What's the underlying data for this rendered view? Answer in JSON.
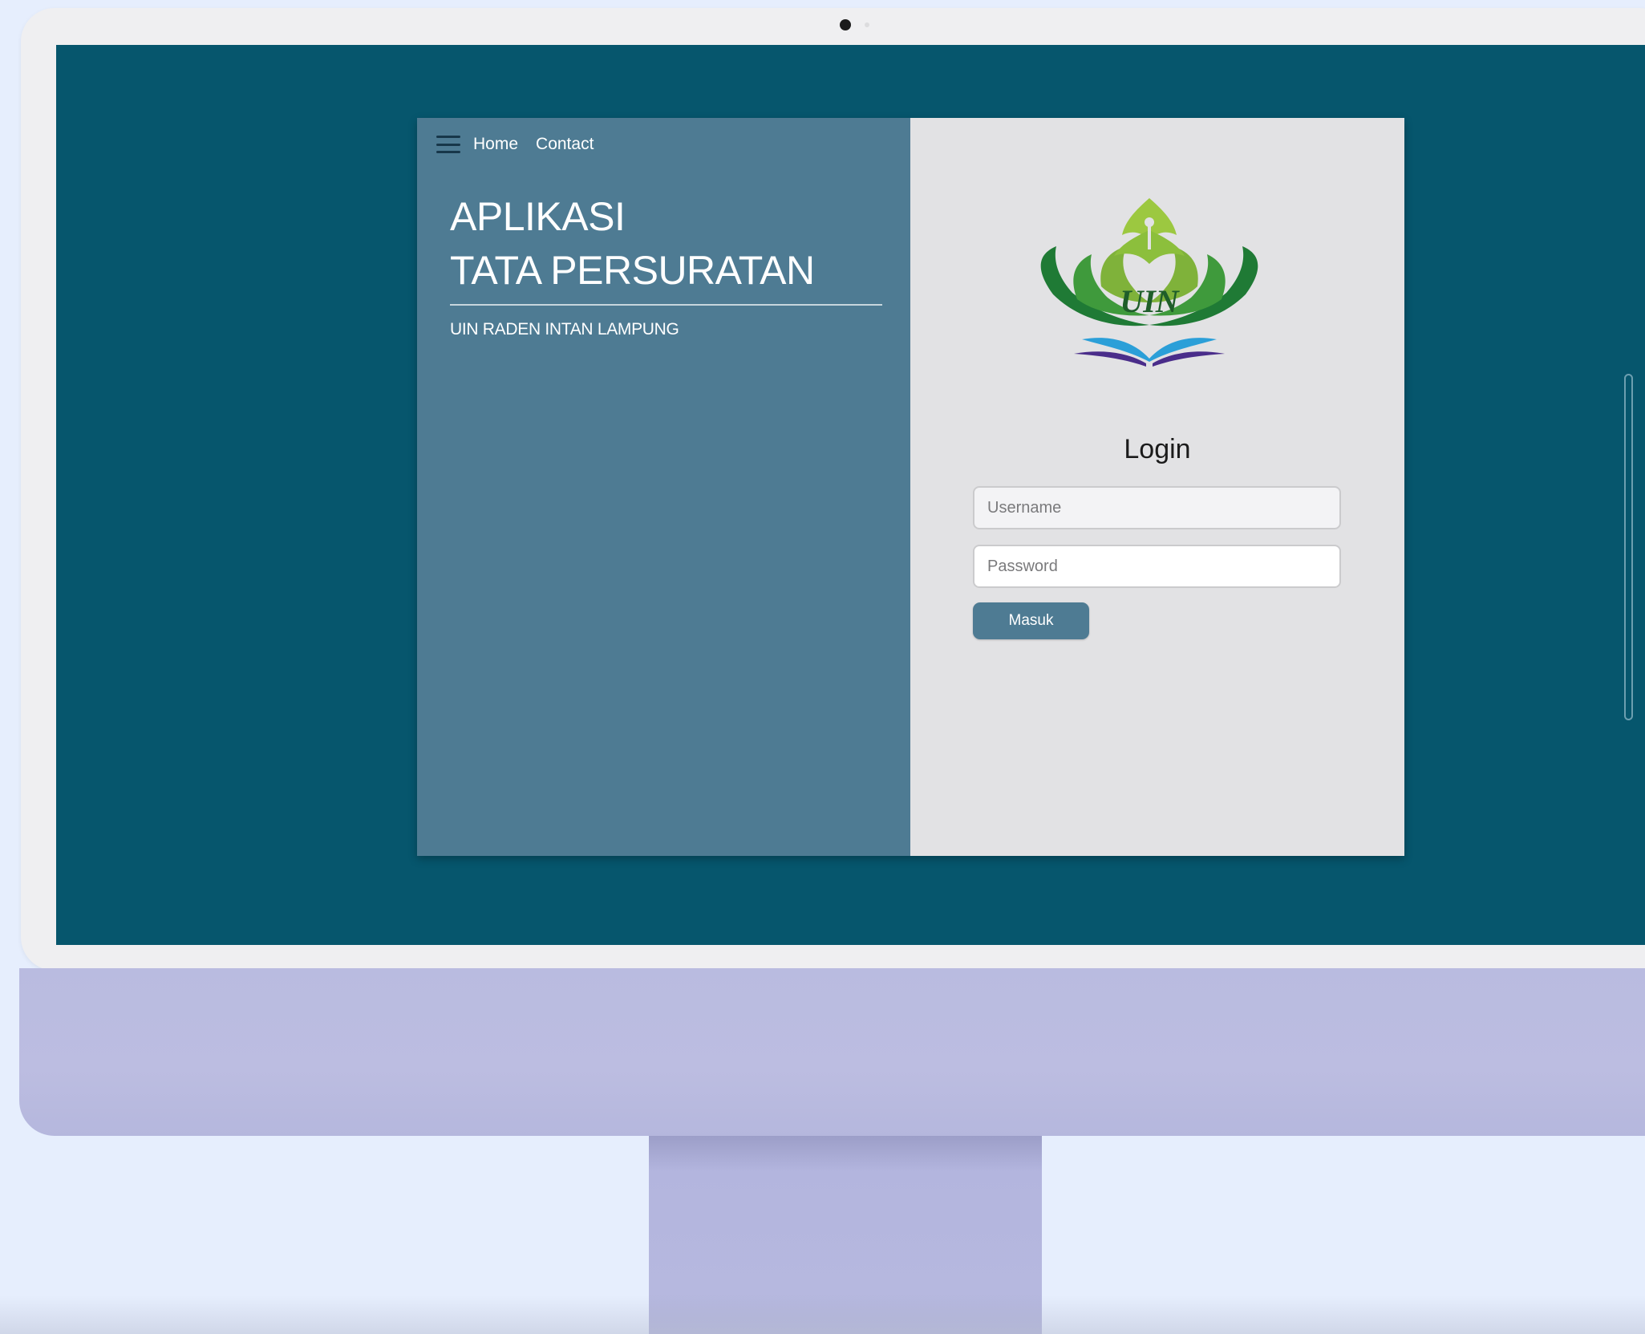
{
  "nav": {
    "items": [
      "Home",
      "Contact"
    ]
  },
  "app": {
    "title_line1": "APLIKASI",
    "title_line2": "TATA PERSURATAN",
    "subtitle": "UIN RADEN INTAN LAMPUNG"
  },
  "logo": {
    "text": "UIN"
  },
  "login": {
    "heading": "Login",
    "username_placeholder": "Username",
    "password_placeholder": "Password",
    "submit_label": "Masuk"
  },
  "colors": {
    "screen_bg": "#06566d",
    "left_panel": "#4e7b93",
    "right_panel": "#e2e2e4",
    "button": "#4e7b93"
  }
}
